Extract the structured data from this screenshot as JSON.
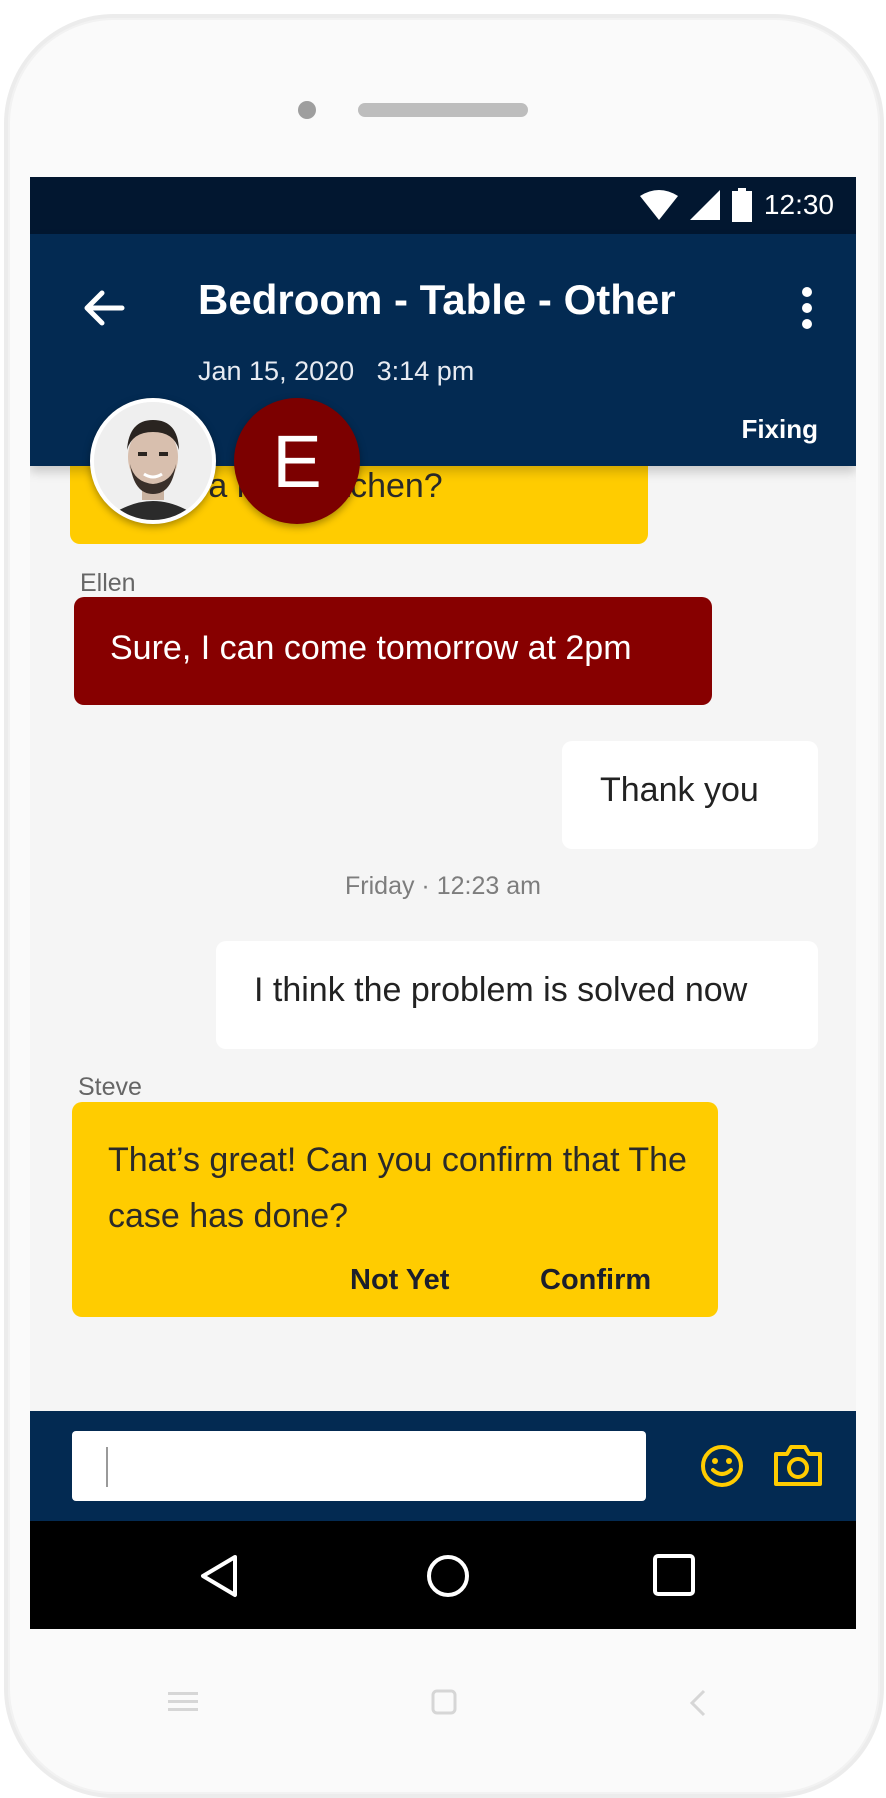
{
  "statusbar": {
    "time": "12:30"
  },
  "appbar": {
    "title": "Bedroom - Table - Other",
    "date": "Jan 15, 2020",
    "time": "3:14 pm",
    "status": "Fixing"
  },
  "avatars": {
    "ellen_initial": "E"
  },
  "messages": {
    "previous": {
      "text": "e a        r her kitchen?"
    },
    "ellen": {
      "sender": "Ellen",
      "text": "Sure, I can come tomorrow at 2pm"
    },
    "thanks": {
      "text": "Thank you"
    },
    "timestamp": "Friday · 12:23 am",
    "solved": {
      "text": "I think the problem is solved now"
    },
    "steve": {
      "sender": "Steve",
      "text": "That’s great! Can you confirm that The case has done?",
      "not_yet_label": "Not Yet",
      "confirm_label": "Confirm"
    }
  },
  "composer": {
    "value": ""
  },
  "colors": {
    "header": "#032a52",
    "statusbar": "#021730",
    "yellow": "#ffcc00",
    "red": "#870000",
    "icon_yellow": "#ffcc00"
  },
  "icons": [
    "back-arrow-icon",
    "more-vert-icon",
    "wifi-icon",
    "signal-icon",
    "battery-icon",
    "emoji-icon",
    "camera-icon",
    "nav-back-icon",
    "nav-home-icon",
    "nav-recent-icon"
  ]
}
